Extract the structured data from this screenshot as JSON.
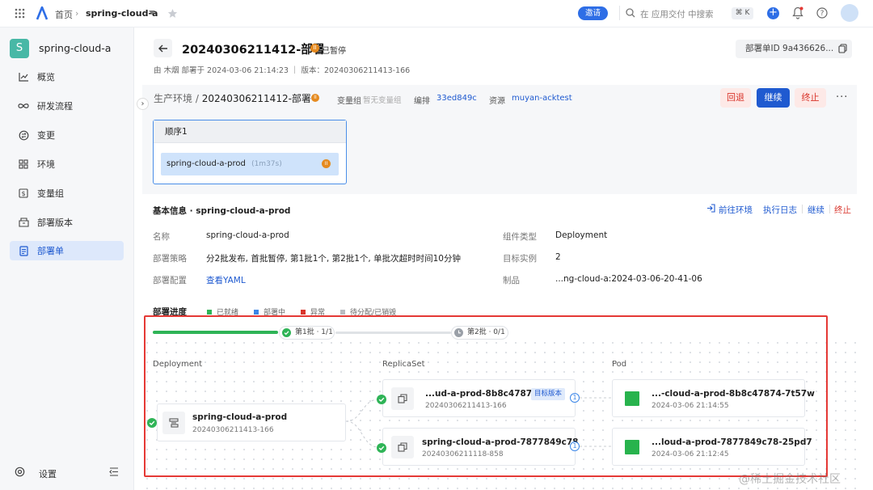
{
  "topbar": {
    "home": "首页",
    "app": "spring-cloud-a",
    "invite": "邀请",
    "search_placeholder": "在 应用交付 中搜索",
    "shortcut": "⌘ K"
  },
  "sidebar": {
    "app_initial": "S",
    "app_name": "spring-cloud-a",
    "items": [
      {
        "label": "概览",
        "icon": "chart-line-icon"
      },
      {
        "label": "研发流程",
        "icon": "infinity-icon"
      },
      {
        "label": "变更",
        "icon": "change-icon"
      },
      {
        "label": "环境",
        "icon": "grid-icon"
      },
      {
        "label": "变量组",
        "icon": "dollar-icon"
      },
      {
        "label": "部署版本",
        "icon": "box-icon"
      },
      {
        "label": "部署单",
        "icon": "document-icon",
        "active": true
      }
    ],
    "settings": "设置"
  },
  "header": {
    "title": "20240306211412-部署",
    "status": "已暂停",
    "meta": "由 木烟 部署于 2024-03-06 21:14:23 ｜ 版本：20240306211413-166",
    "order_id": "部署单ID 9a436626..."
  },
  "stage": {
    "env_prefix": "生产环境",
    "title": "20240306211412-部署",
    "var_group_label": "变量组",
    "var_group_value": "暂无变量组",
    "orch_label": "编排",
    "orch_value": "33ed849c",
    "resource_label": "资源",
    "resource_value": "muyan-acktest",
    "rollback": "回退",
    "continue": "继续",
    "terminate": "终止"
  },
  "sequence": {
    "title": "顺序1",
    "item_name": "spring-cloud-a-prod",
    "item_time": "(1m37s)"
  },
  "basic": {
    "title": "基本信息 · spring-cloud-a-prod",
    "go_env": "前往环境",
    "exec_log": "执行日志",
    "continue": "继续",
    "terminate": "终止",
    "name_label": "名称",
    "name_value": "spring-cloud-a-prod",
    "strategy_label": "部署策略",
    "strategy_value": "分2批发布, 首批暂停, 第1批1个, 第2批1个, 单批次超时时间10分钟",
    "config_label": "部署配置",
    "config_value": "查看YAML",
    "type_label": "组件类型",
    "type_value": "Deployment",
    "replicas_label": "目标实例",
    "replicas_value": "2",
    "artifact_label": "制品",
    "artifact_value": "...ng-cloud-a:2024-03-06-20-41-06"
  },
  "progress": {
    "title": "部署进度",
    "legend": [
      {
        "label": "已就绪",
        "color": "#2fb457"
      },
      {
        "label": "部署中",
        "color": "#3b86e8"
      },
      {
        "label": "异常",
        "color": "#d9342b"
      },
      {
        "label": "待分配/已销毁",
        "color": "#b9bcc2"
      }
    ],
    "batch1": "第1批 · 1/1",
    "batch2": "第2批 · 0/1"
  },
  "topology": {
    "col_deployment": "Deployment",
    "col_replicaset": "ReplicaSet",
    "col_pod": "Pod",
    "deployment": {
      "name": "spring-cloud-a-prod",
      "version": "20240306211413-166"
    },
    "replicasets": [
      {
        "name": "...ud-a-prod-8b8c47874",
        "version": "20240306211413-166",
        "tag": "目标版本",
        "count": "1"
      },
      {
        "name": "spring-cloud-a-prod-7877849c78",
        "version": "20240306211118-858",
        "count": "1"
      }
    ],
    "pods": [
      {
        "name": "...-cloud-a-prod-8b8c47874-7t57w",
        "time": "2024-03-06 21:14:55"
      },
      {
        "name": "...loud-a-prod-7877849c78-25pd7",
        "time": "2024-03-06 21:12:45"
      }
    ]
  },
  "watermark": "@稀土掘金技术社区"
}
